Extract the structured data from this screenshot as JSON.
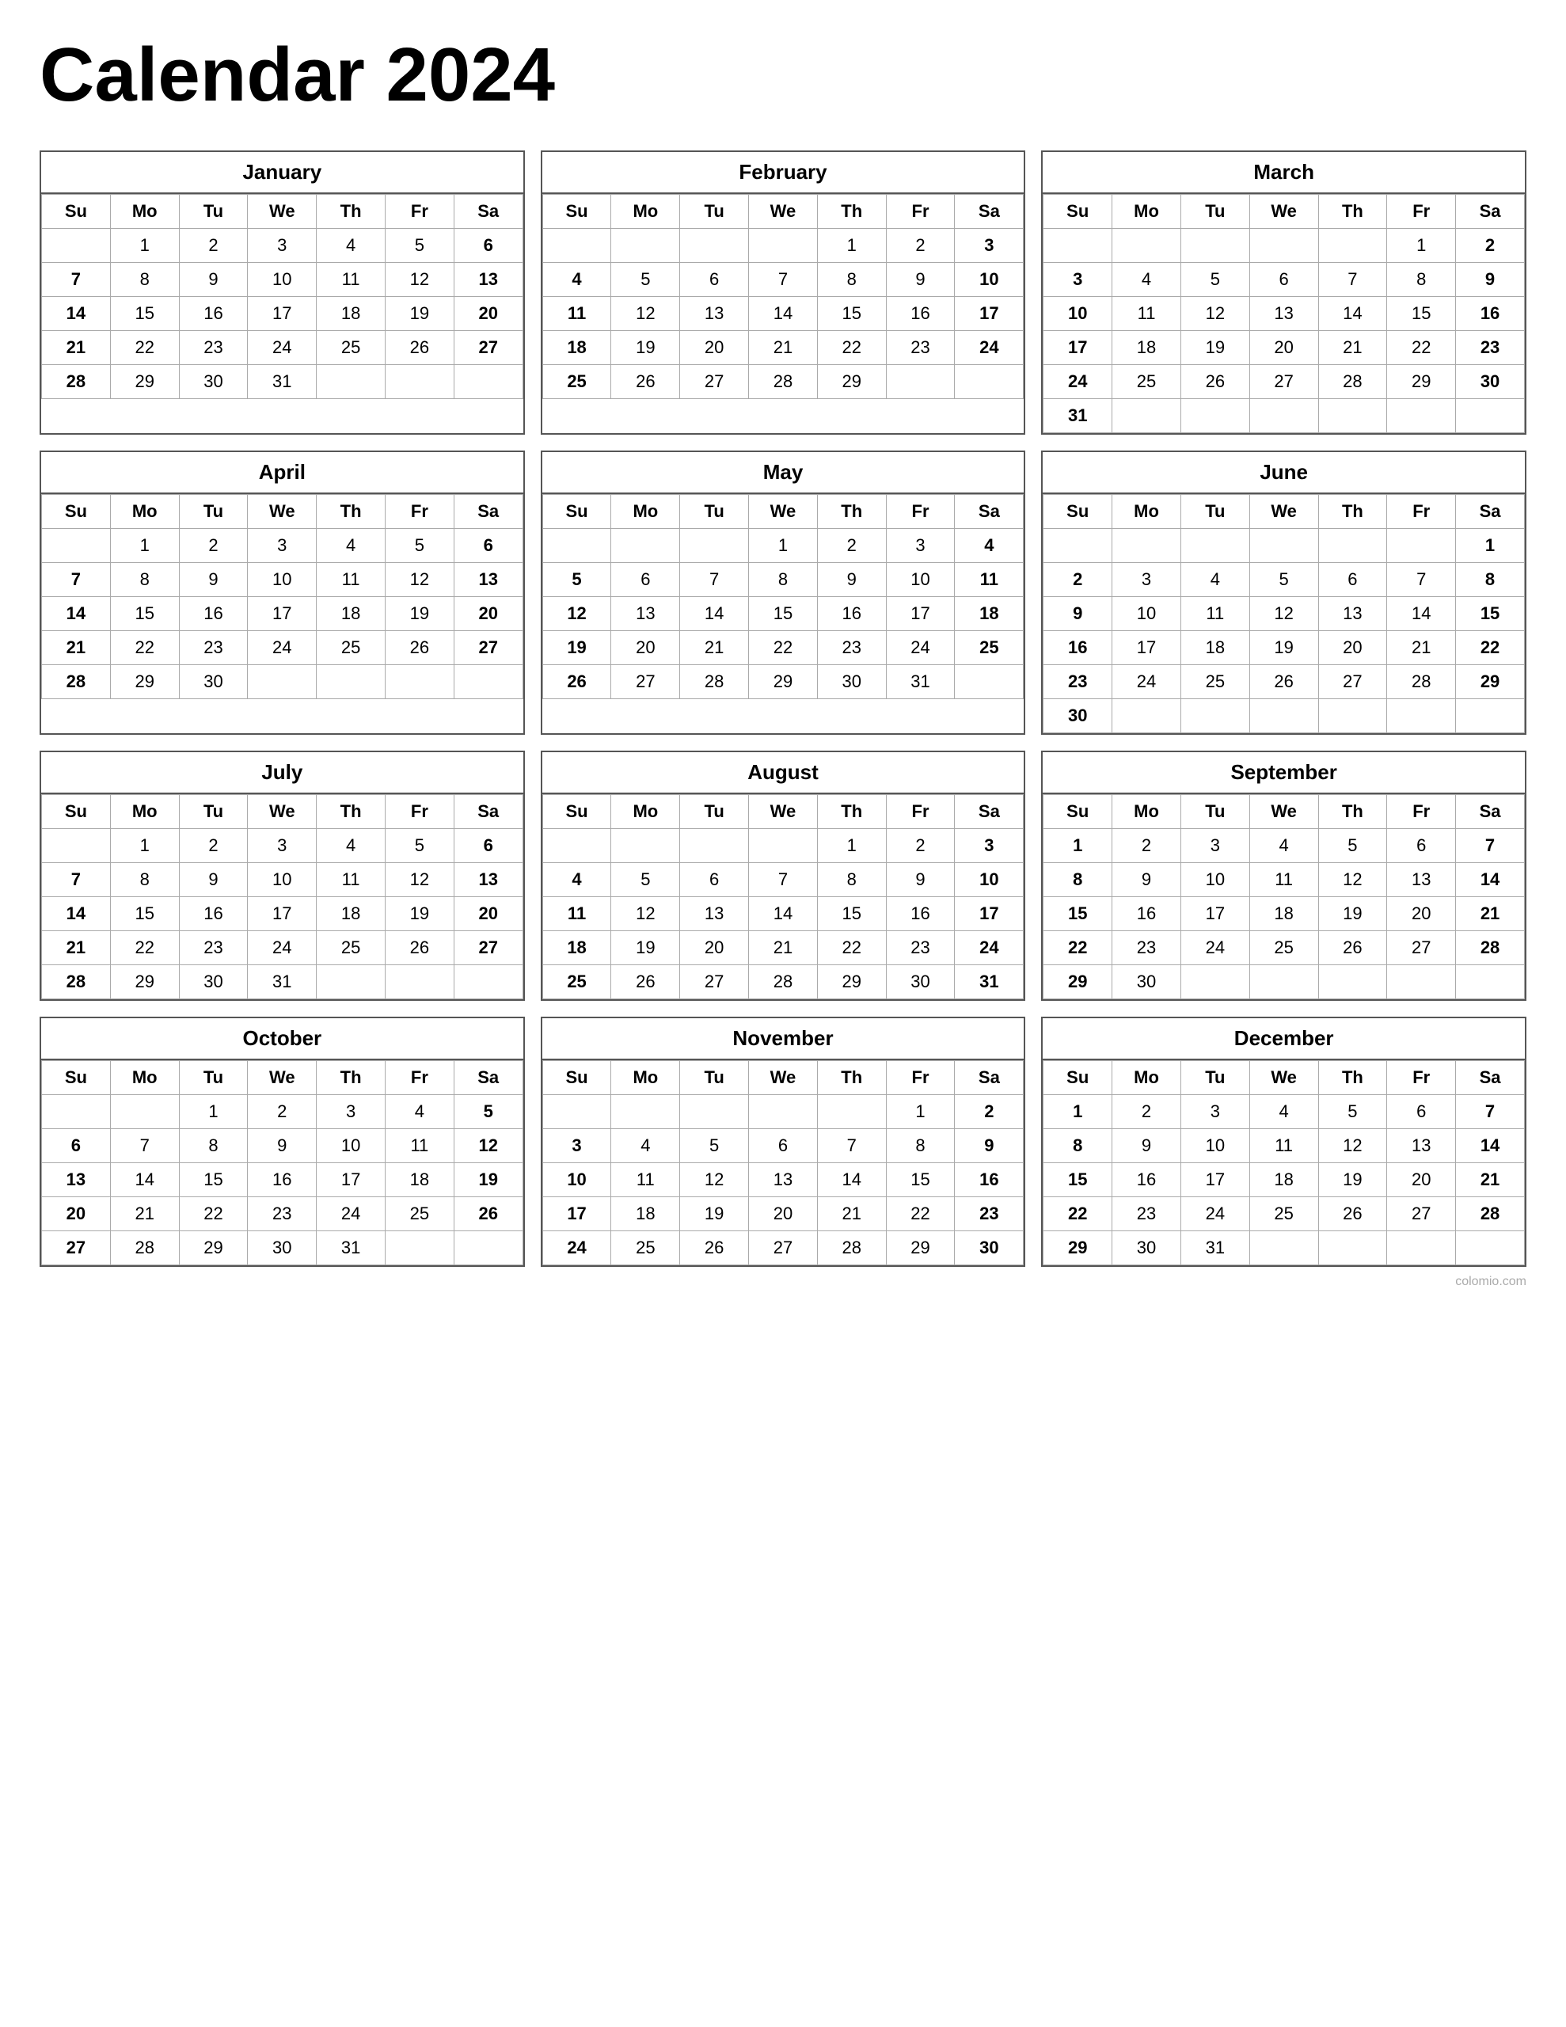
{
  "title": "Calendar 2024",
  "months": [
    {
      "name": "January",
      "weeks": [
        [
          "",
          "1",
          "2",
          "3",
          "4",
          "5",
          "6"
        ],
        [
          "7",
          "8",
          "9",
          "10",
          "11",
          "12",
          "13"
        ],
        [
          "14",
          "15",
          "16",
          "17",
          "18",
          "19",
          "20"
        ],
        [
          "21",
          "22",
          "23",
          "24",
          "25",
          "26",
          "27"
        ],
        [
          "28",
          "29",
          "30",
          "31",
          "",
          "",
          ""
        ]
      ]
    },
    {
      "name": "February",
      "weeks": [
        [
          "",
          "",
          "",
          "",
          "1",
          "2",
          "3"
        ],
        [
          "4",
          "5",
          "6",
          "7",
          "8",
          "9",
          "10"
        ],
        [
          "11",
          "12",
          "13",
          "14",
          "15",
          "16",
          "17"
        ],
        [
          "18",
          "19",
          "20",
          "21",
          "22",
          "23",
          "24"
        ],
        [
          "25",
          "26",
          "27",
          "28",
          "29",
          "",
          ""
        ]
      ]
    },
    {
      "name": "March",
      "weeks": [
        [
          "",
          "",
          "",
          "",
          "",
          "1",
          "2"
        ],
        [
          "3",
          "4",
          "5",
          "6",
          "7",
          "8",
          "9"
        ],
        [
          "10",
          "11",
          "12",
          "13",
          "14",
          "15",
          "16"
        ],
        [
          "17",
          "18",
          "19",
          "20",
          "21",
          "22",
          "23"
        ],
        [
          "24",
          "25",
          "26",
          "27",
          "28",
          "29",
          "30"
        ],
        [
          "31",
          "",
          "",
          "",
          "",
          "",
          ""
        ]
      ]
    },
    {
      "name": "April",
      "weeks": [
        [
          "",
          "1",
          "2",
          "3",
          "4",
          "5",
          "6"
        ],
        [
          "7",
          "8",
          "9",
          "10",
          "11",
          "12",
          "13"
        ],
        [
          "14",
          "15",
          "16",
          "17",
          "18",
          "19",
          "20"
        ],
        [
          "21",
          "22",
          "23",
          "24",
          "25",
          "26",
          "27"
        ],
        [
          "28",
          "29",
          "30",
          "",
          "",
          "",
          ""
        ]
      ]
    },
    {
      "name": "May",
      "weeks": [
        [
          "",
          "",
          "",
          "1",
          "2",
          "3",
          "4"
        ],
        [
          "5",
          "6",
          "7",
          "8",
          "9",
          "10",
          "11"
        ],
        [
          "12",
          "13",
          "14",
          "15",
          "16",
          "17",
          "18"
        ],
        [
          "19",
          "20",
          "21",
          "22",
          "23",
          "24",
          "25"
        ],
        [
          "26",
          "27",
          "28",
          "29",
          "30",
          "31",
          ""
        ]
      ]
    },
    {
      "name": "June",
      "weeks": [
        [
          "",
          "",
          "",
          "",
          "",
          "",
          "1"
        ],
        [
          "2",
          "3",
          "4",
          "5",
          "6",
          "7",
          "8"
        ],
        [
          "9",
          "10",
          "11",
          "12",
          "13",
          "14",
          "15"
        ],
        [
          "16",
          "17",
          "18",
          "19",
          "20",
          "21",
          "22"
        ],
        [
          "23",
          "24",
          "25",
          "26",
          "27",
          "28",
          "29"
        ],
        [
          "30",
          "",
          "",
          "",
          "",
          "",
          ""
        ]
      ]
    },
    {
      "name": "July",
      "weeks": [
        [
          "",
          "1",
          "2",
          "3",
          "4",
          "5",
          "6"
        ],
        [
          "7",
          "8",
          "9",
          "10",
          "11",
          "12",
          "13"
        ],
        [
          "14",
          "15",
          "16",
          "17",
          "18",
          "19",
          "20"
        ],
        [
          "21",
          "22",
          "23",
          "24",
          "25",
          "26",
          "27"
        ],
        [
          "28",
          "29",
          "30",
          "31",
          "",
          "",
          ""
        ]
      ]
    },
    {
      "name": "August",
      "weeks": [
        [
          "",
          "",
          "",
          "",
          "1",
          "2",
          "3"
        ],
        [
          "4",
          "5",
          "6",
          "7",
          "8",
          "9",
          "10"
        ],
        [
          "11",
          "12",
          "13",
          "14",
          "15",
          "16",
          "17"
        ],
        [
          "18",
          "19",
          "20",
          "21",
          "22",
          "23",
          "24"
        ],
        [
          "25",
          "26",
          "27",
          "28",
          "29",
          "30",
          "31"
        ]
      ]
    },
    {
      "name": "September",
      "weeks": [
        [
          "1",
          "2",
          "3",
          "4",
          "5",
          "6",
          "7"
        ],
        [
          "8",
          "9",
          "10",
          "11",
          "12",
          "13",
          "14"
        ],
        [
          "15",
          "16",
          "17",
          "18",
          "19",
          "20",
          "21"
        ],
        [
          "22",
          "23",
          "24",
          "25",
          "26",
          "27",
          "28"
        ],
        [
          "29",
          "30",
          "",
          "",
          "",
          "",
          ""
        ]
      ]
    },
    {
      "name": "October",
      "weeks": [
        [
          "",
          "",
          "1",
          "2",
          "3",
          "4",
          "5"
        ],
        [
          "6",
          "7",
          "8",
          "9",
          "10",
          "11",
          "12"
        ],
        [
          "13",
          "14",
          "15",
          "16",
          "17",
          "18",
          "19"
        ],
        [
          "20",
          "21",
          "22",
          "23",
          "24",
          "25",
          "26"
        ],
        [
          "27",
          "28",
          "29",
          "30",
          "31",
          "",
          ""
        ]
      ]
    },
    {
      "name": "November",
      "weeks": [
        [
          "",
          "",
          "",
          "",
          "",
          "1",
          "2"
        ],
        [
          "3",
          "4",
          "5",
          "6",
          "7",
          "8",
          "9"
        ],
        [
          "10",
          "11",
          "12",
          "13",
          "14",
          "15",
          "16"
        ],
        [
          "17",
          "18",
          "19",
          "20",
          "21",
          "22",
          "23"
        ],
        [
          "24",
          "25",
          "26",
          "27",
          "28",
          "29",
          "30"
        ]
      ]
    },
    {
      "name": "December",
      "weeks": [
        [
          "1",
          "2",
          "3",
          "4",
          "5",
          "6",
          "7"
        ],
        [
          "8",
          "9",
          "10",
          "11",
          "12",
          "13",
          "14"
        ],
        [
          "15",
          "16",
          "17",
          "18",
          "19",
          "20",
          "21"
        ],
        [
          "22",
          "23",
          "24",
          "25",
          "26",
          "27",
          "28"
        ],
        [
          "29",
          "30",
          "31",
          "",
          "",
          "",
          ""
        ]
      ]
    }
  ],
  "days": [
    "Su",
    "Mo",
    "Tu",
    "We",
    "Th",
    "Fr",
    "Sa"
  ],
  "watermark": "colomio.com"
}
